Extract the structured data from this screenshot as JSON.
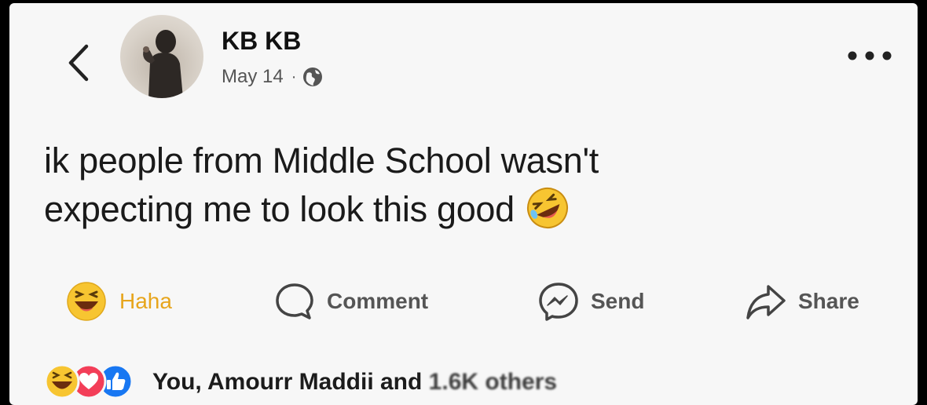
{
  "post": {
    "author": "KB KB",
    "date": "May 14",
    "separator": "·",
    "privacy_icon": "globe-icon",
    "text_line1": "ik people from Middle School wasn't",
    "text_line2": "expecting me to look this good",
    "inline_emoji": "rolling-on-floor-laughing-emoji"
  },
  "actions": {
    "haha_label": "Haha",
    "comment_label": "Comment",
    "send_label": "Send",
    "share_label": "Share"
  },
  "reactions": {
    "summary_prefix": "You, Amourr Maddii and ",
    "summary_blurred": "1.6K others",
    "icons": [
      "haha-reaction-icon",
      "love-reaction-icon",
      "like-reaction-icon"
    ]
  },
  "colors": {
    "haha_accent": "#e7a51c",
    "like_blue": "#1877f2",
    "love_red": "#f33e58"
  }
}
